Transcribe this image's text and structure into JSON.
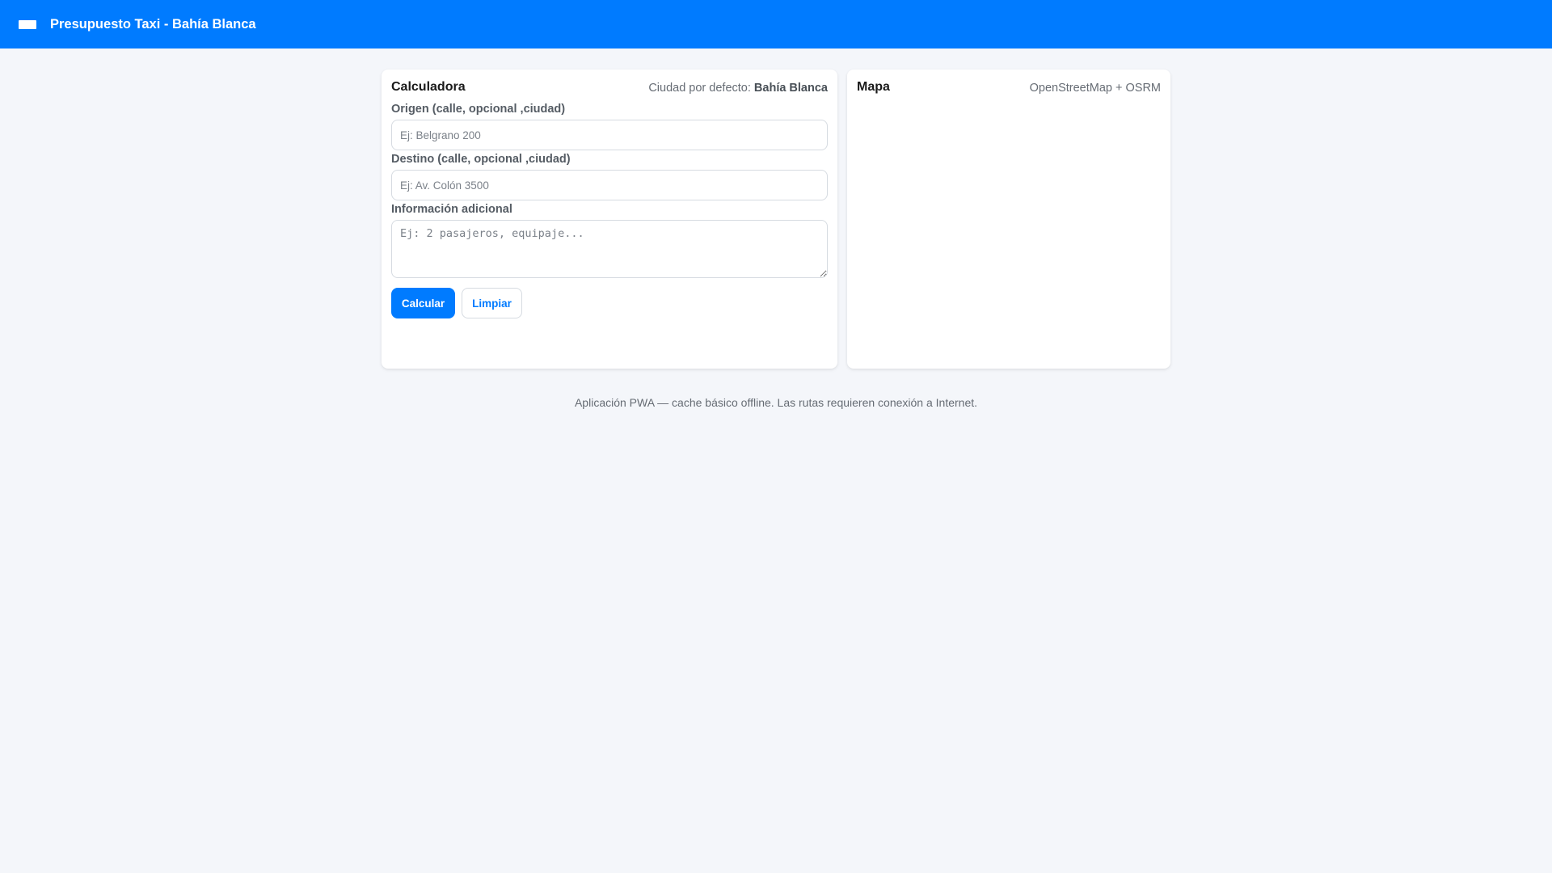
{
  "header": {
    "title": "Presupuesto Taxi - Bahía Blanca",
    "icon": "argentina-flag-icon",
    "background_color": "#007bff"
  },
  "calculator": {
    "title": "Calculadora",
    "city_label": "Ciudad por defecto:",
    "city_value": "Bahía Blanca",
    "origin": {
      "label": "Origen (calle, opcional ,ciudad)",
      "placeholder": "Ej: Belgrano 200",
      "value": ""
    },
    "destination": {
      "label": "Destino (calle, opcional ,ciudad)",
      "placeholder": "Ej: Av. Colón 3500",
      "value": ""
    },
    "additional_info": {
      "label": "Información adicional",
      "placeholder": "Ej: 2 pasajeros, equipaje...",
      "value": ""
    },
    "buttons": {
      "calculate": "Calcular",
      "clear": "Limpiar"
    }
  },
  "map": {
    "title": "Mapa",
    "provider": "OpenStreetMap + OSRM"
  },
  "footer": {
    "note": "Aplicación PWA — cache básico offline. Las rutas requieren conexión a Internet."
  },
  "colors": {
    "accent": "#007bff",
    "page_background": "#f4f6fa",
    "card_background": "#ffffff"
  }
}
